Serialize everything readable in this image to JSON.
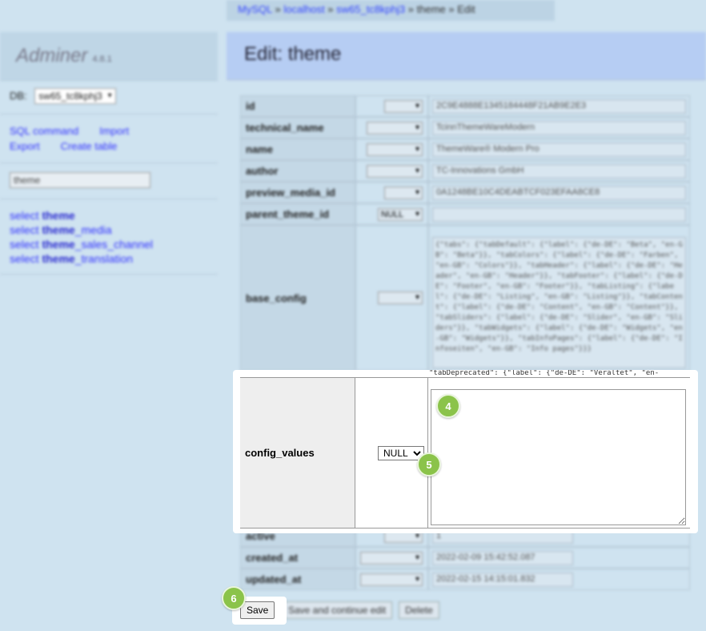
{
  "breadcrumb": {
    "items": [
      "MySQL",
      "localhost",
      "sw65_tc8kphj3",
      "theme"
    ],
    "current": "Edit",
    "separator": "»"
  },
  "menu": {
    "app_name": "Adminer",
    "version": "4.8.1",
    "db_label": "DB:",
    "db_value": "sw65_tc8kphj3",
    "links": [
      "SQL command",
      "Import",
      "Export",
      "Create table"
    ],
    "table_filter_value": "theme",
    "tables": [
      {
        "prefix": "select ",
        "bold": "theme",
        "suffix": ""
      },
      {
        "prefix": "select ",
        "bold": "theme",
        "suffix": "_media"
      },
      {
        "prefix": "select ",
        "bold": "theme",
        "suffix": "_sales_channel"
      },
      {
        "prefix": "select ",
        "bold": "theme",
        "suffix": "_translation"
      }
    ]
  },
  "page": {
    "title": "Edit: theme"
  },
  "fields": {
    "id": {
      "name": "id",
      "value": "2C9E4888E1345184448F21AB9E2E3"
    },
    "technical_name": {
      "name": "technical_name",
      "value": "TcinnThemeWareModern"
    },
    "name": {
      "name": "name",
      "value": "ThemeWare® Modern Pro"
    },
    "author": {
      "name": "author",
      "value": "TC-Innovations GmbH"
    },
    "preview_media_id": {
      "name": "preview_media_id",
      "value": "0A1248BE10C4DEABTCF023EFAA8CE8"
    },
    "parent_theme_id": {
      "name": "parent_theme_id",
      "func": "NULL",
      "value": ""
    },
    "base_config": {
      "name": "base_config",
      "value": "{\"tabs\": {\"tabDefault\": {\"label\": {\"de-DE\": \"Beta\", \"en-GB\": \"Beta\"}}, \"tabColors\": {\"label\": {\"de-DE\": \"Farben\", \"en-GB\": \"Colors\"}}, \"tabHeader\": {\"label\": {\"de-DE\": \"Header\", \"en-GB\": \"Header\"}}, \"tabFooter\": {\"label\": {\"de-DE\": \"Footer\", \"en-GB\": \"Footer\"}}, \"tabListing\": {\"label\": {\"de-DE\": \"Listing\", \"en-GB\": \"Listing\"}}, \"tabContent\": {\"label\": {\"de-DE\": \"Content\", \"en-GB\": \"Content\"}}, \"tabSliders\": {\"label\": {\"de-DE\": \"Slider\", \"en-GB\": \"Sliders\"}}, \"tabWidgets\": {\"label\": {\"de-DE\": \"Widgets\", \"en-GB\": \"Widgets\"}}, \"tabInfoPages\": {\"label\": {\"de-DE\": \"Infoseiten\", \"en-GB\": \"Info pages\"}}}",
      "peek": "\"tabDeprecated\": {\"label\": {\"de-DE\": \"Veraltet\", \"en-"
    },
    "config_values": {
      "name": "config_values",
      "func": "NULL",
      "value": ""
    },
    "active": {
      "name": "active",
      "value": "1"
    },
    "created_at": {
      "name": "created_at",
      "value": "2022-02-09 15:42:52.087"
    },
    "updated_at": {
      "name": "updated_at",
      "value": "2022-02-15 14:15:01.832"
    }
  },
  "buttons": {
    "save": "Save",
    "save_continue": "Save and continue edit",
    "delete": "Delete"
  },
  "markers": [
    "4",
    "5",
    "6"
  ],
  "colors": {
    "marker": "#8bc34a",
    "link": "#3333ff",
    "title_bar": "#b6cdf3"
  }
}
